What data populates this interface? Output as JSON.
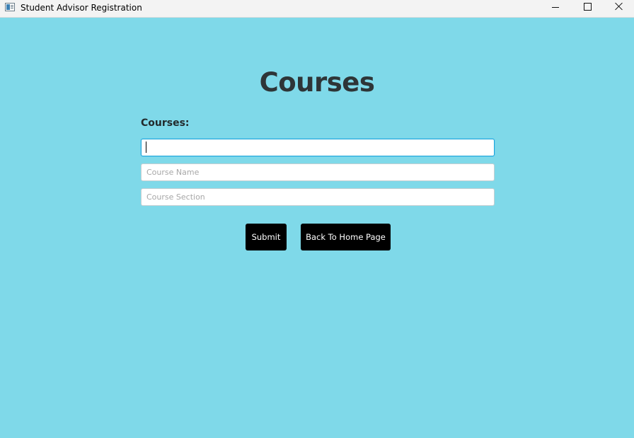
{
  "window": {
    "title": "Student Advisor Registration",
    "controls": {
      "minimize_icon": "minimize-icon",
      "maximize_icon": "maximize-icon",
      "close_icon": "close-icon"
    }
  },
  "colors": {
    "background": "#7fd9e9",
    "heading": "#2e3537",
    "button": "#000000",
    "focus_border": "#1ca6d6"
  },
  "form": {
    "heading": "Courses",
    "label": "Courses:",
    "fields": [
      {
        "value": "",
        "placeholder": "",
        "focused": true
      },
      {
        "value": "",
        "placeholder": "Course Name",
        "focused": false
      },
      {
        "value": "",
        "placeholder": "Course Section",
        "focused": false
      }
    ],
    "buttons": {
      "submit": "Submit",
      "back": "Back To Home Page"
    }
  }
}
